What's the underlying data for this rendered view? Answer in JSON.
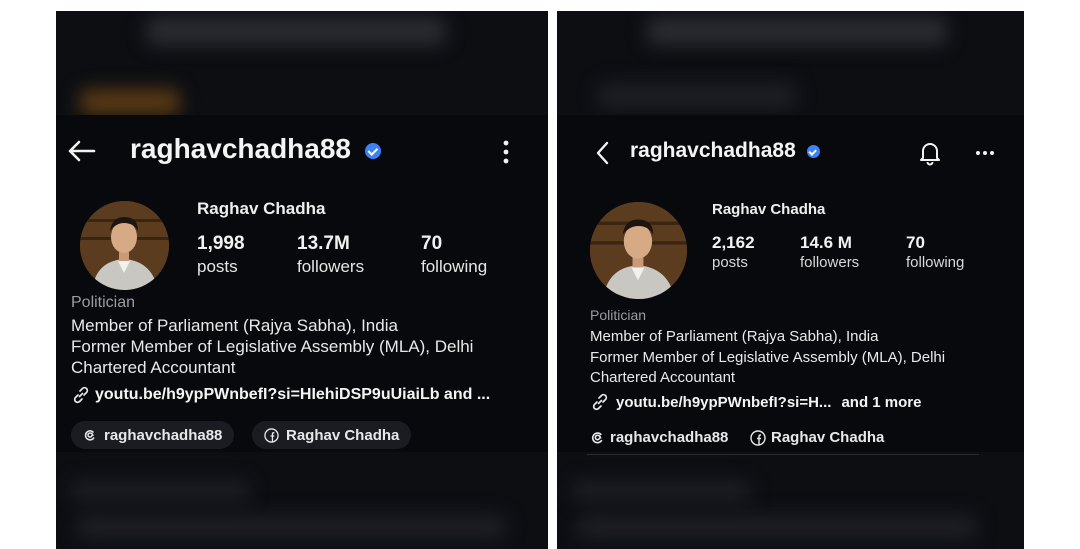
{
  "left": {
    "header": {
      "back_icon": "arrow-left-icon",
      "username": "raghavchadha88",
      "menu_icon": "vertical-dots-icon"
    },
    "profile": {
      "display_name": "Raghav Chadha",
      "stats": [
        {
          "value": "1,998",
          "label": "posts"
        },
        {
          "value": "13.7M",
          "label": "followers"
        },
        {
          "value": "70",
          "label": "following"
        }
      ],
      "category": "Politician",
      "bio": [
        "Member of Parliament (Rajya Sabha), India",
        "Former Member of Legislative Assembly (MLA), Delhi",
        "Chartered Accountant"
      ],
      "link": "youtu.be/h9ypPWnbefI?si=HIehiDSP9uUiaiLb and ...",
      "chips": [
        {
          "icon": "threads-icon",
          "label": "raghavchadha88"
        },
        {
          "icon": "facebook-icon",
          "label": "Raghav Chadha"
        }
      ]
    }
  },
  "right": {
    "header": {
      "back_icon": "chevron-left-icon",
      "username": "raghavchadha88",
      "bell_icon": "bell-icon",
      "menu_icon": "horizontal-dots-icon"
    },
    "profile": {
      "display_name": "Raghav Chadha",
      "stats": [
        {
          "value": "2,162",
          "label": "posts"
        },
        {
          "value": "14.6 M",
          "label": "followers"
        },
        {
          "value": "70",
          "label": "following"
        }
      ],
      "category": "Politician",
      "bio": [
        "Member of Parliament (Rajya Sabha), India",
        "Former Member of Legislative Assembly (MLA), Delhi",
        "Chartered Accountant"
      ],
      "link": "youtu.be/h9ypPWnbefI?si=H...",
      "link_more": "and 1 more",
      "chips": [
        {
          "icon": "threads-icon",
          "label": "raghavchadha88"
        },
        {
          "icon": "facebook-icon",
          "label": "Raghav Chadha"
        }
      ]
    }
  },
  "colors": {
    "background": "#0c0e12",
    "verified": "#3b82f6",
    "muted_text": "#9a9ca2"
  }
}
